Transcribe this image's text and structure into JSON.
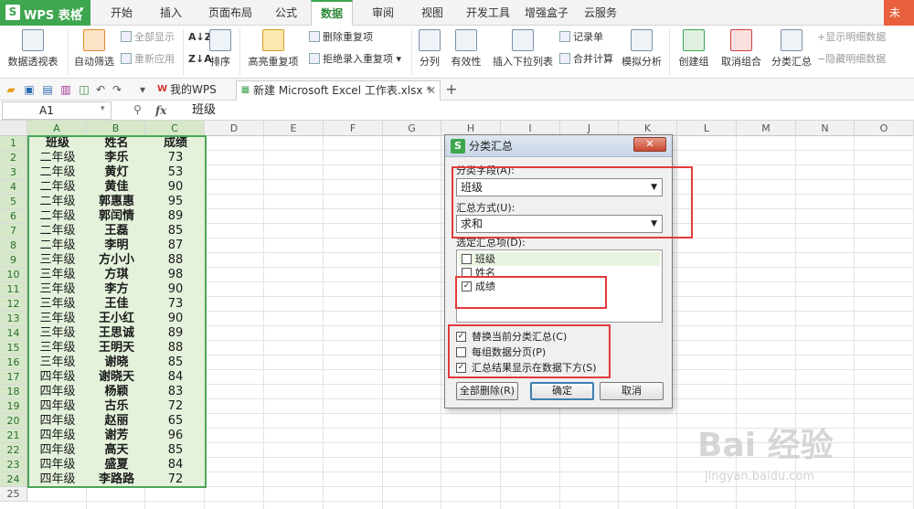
{
  "app": {
    "logo_text": "WPS 表格",
    "login_text": "未"
  },
  "menu_tabs": [
    "开始",
    "插入",
    "页面布局",
    "公式",
    "数据",
    "审阅",
    "视图",
    "开发工具",
    "增强盒子",
    "云服务"
  ],
  "active_menu_tab": "数据",
  "ribbon": {
    "pivot": "数据透视表",
    "autofilter": "自动筛选",
    "show_all": "全部显示",
    "reapply": "重新应用",
    "sort": "排序",
    "highlight_dup": "高亮重复项",
    "delete_dup": "删除重复项",
    "reject_dup": "拒绝录入重复项",
    "split": "分列",
    "validity": "有效性",
    "insert_dropdown": "插入下拉列表",
    "record_form": "记录单",
    "consolidate": "合并计算",
    "simulate": "模拟分析",
    "create_group": "创建组",
    "ungroup": "取消组合",
    "subtotal": "分类汇总",
    "show_detail": "显示明细数据",
    "hide_detail": "隐藏明细数据"
  },
  "doc_tabs": {
    "my_wps": "我的WPS",
    "file": "新建 Microsoft Excel 工作表.xlsx *"
  },
  "formula_bar": {
    "cell_ref": "A1",
    "fx": "fx",
    "value": "班级"
  },
  "columns": [
    "A",
    "B",
    "C",
    "D",
    "E",
    "F",
    "G",
    "H",
    "I",
    "J",
    "K",
    "L",
    "M",
    "N",
    "O"
  ],
  "rows": [
    "1",
    "2",
    "3",
    "4",
    "5",
    "6",
    "7",
    "8",
    "9",
    "10",
    "11",
    "12",
    "13",
    "14",
    "15",
    "16",
    "17",
    "18",
    "19",
    "20",
    "21",
    "22",
    "23",
    "24",
    "25"
  ],
  "table": {
    "headers": [
      "班级",
      "姓名",
      "成绩"
    ],
    "data": [
      [
        "二年级",
        "李乐",
        "73"
      ],
      [
        "二年级",
        "黄灯",
        "53"
      ],
      [
        "二年级",
        "黄佳",
        "90"
      ],
      [
        "二年级",
        "郭惠惠",
        "95"
      ],
      [
        "二年级",
        "郭闰情",
        "89"
      ],
      [
        "二年级",
        "王磊",
        "85"
      ],
      [
        "二年级",
        "李明",
        "87"
      ],
      [
        "三年级",
        "方小小",
        "88"
      ],
      [
        "三年级",
        "方琪",
        "98"
      ],
      [
        "三年级",
        "李方",
        "90"
      ],
      [
        "三年级",
        "王佳",
        "73"
      ],
      [
        "三年级",
        "王小红",
        "90"
      ],
      [
        "三年级",
        "王思诚",
        "89"
      ],
      [
        "三年级",
        "王明天",
        "88"
      ],
      [
        "三年级",
        "谢晓",
        "85"
      ],
      [
        "四年级",
        "谢晓天",
        "84"
      ],
      [
        "四年级",
        "杨颖",
        "83"
      ],
      [
        "四年级",
        "古乐",
        "72"
      ],
      [
        "四年级",
        "赵丽",
        "65"
      ],
      [
        "四年级",
        "谢芳",
        "96"
      ],
      [
        "四年级",
        "高天",
        "85"
      ],
      [
        "四年级",
        "盛夏",
        "84"
      ],
      [
        "四年级",
        "李路路",
        "72"
      ]
    ]
  },
  "dialog": {
    "title": "分类汇总",
    "close": "✕",
    "group_field_label": "分类字段(A):",
    "group_field_value": "班级",
    "method_label": "汇总方式(U):",
    "method_value": "求和",
    "items_label": "选定汇总项(D):",
    "items": [
      {
        "label": "班级",
        "checked": false
      },
      {
        "label": "姓名",
        "checked": false
      },
      {
        "label": "成绩",
        "checked": true
      }
    ],
    "options": [
      {
        "label": "替换当前分类汇总(C)",
        "checked": true
      },
      {
        "label": "每组数据分页(P)",
        "checked": false
      },
      {
        "label": "汇总结果显示在数据下方(S)",
        "checked": true
      }
    ],
    "remove_all": "全部删除(R)",
    "ok": "确定",
    "cancel": "取消"
  },
  "watermark": {
    "logo": "Bai 经验",
    "url": "jingyan.baidu.com"
  },
  "colors": {
    "brand_green": "#3da64e",
    "selection_fill": "#e4f2dc",
    "annotation_red": "#e23b3b"
  }
}
